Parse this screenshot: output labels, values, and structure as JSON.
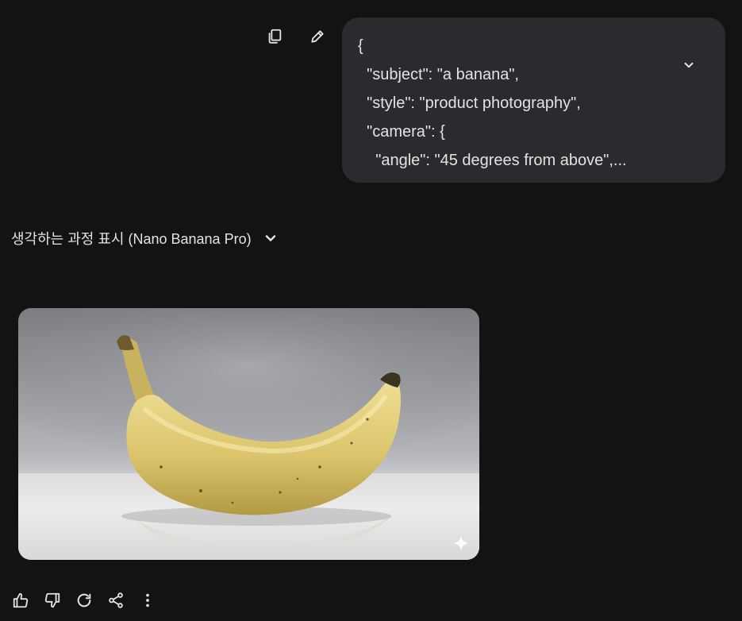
{
  "prompt": {
    "lines": [
      "{",
      "  \"subject\": \"a banana\",",
      "  \"style\": \"product photography\",",
      "  \"camera\": {",
      "    \"angle\": \"45 degrees from above\",..."
    ],
    "actions": [
      "copy-icon",
      "edit-icon"
    ],
    "expand_icon": "chevron-down-icon"
  },
  "thinking": {
    "label": "생각하는 과정 표시 (Nano Banana Pro)",
    "icon": "chevron-down-icon"
  },
  "generated_image": {
    "badge_icon": "sparkle-icon"
  },
  "response_actions": [
    "thumbs-up-icon",
    "thumbs-down-icon",
    "redo-icon",
    "share-icon",
    "more-vert-icon"
  ],
  "colors": {
    "background": "#131314",
    "bubble": "#2a2b2e",
    "text": "#e3e3e3",
    "banana": "#e3cf7a"
  }
}
